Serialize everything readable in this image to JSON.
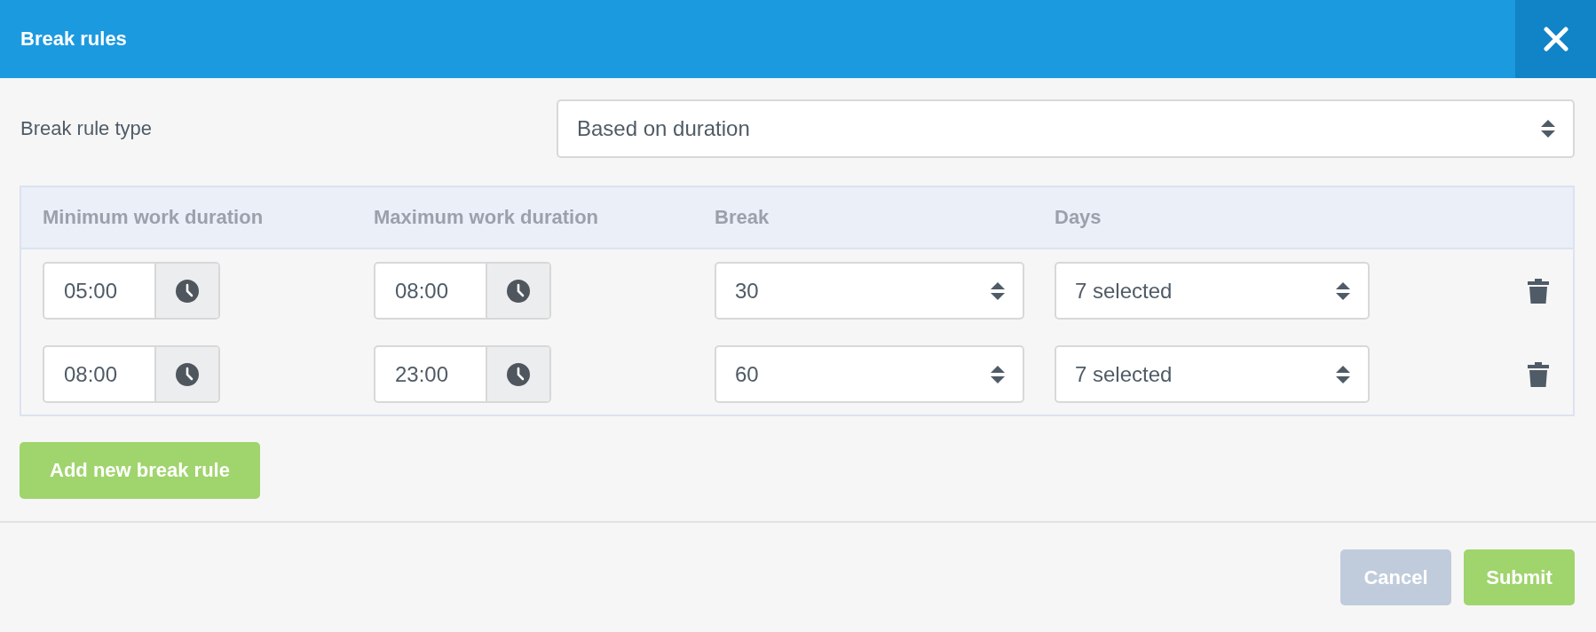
{
  "dialog": {
    "title": "Break rules"
  },
  "break_rule_type": {
    "label": "Break rule type",
    "value": "Based on duration"
  },
  "table": {
    "columns": [
      "Minimum work duration",
      "Maximum work duration",
      "Break",
      "Days"
    ],
    "rows": [
      {
        "minimum": "05:00",
        "maximum": "08:00",
        "break": "30",
        "days": "7 selected"
      },
      {
        "minimum": "08:00",
        "maximum": "23:00",
        "break": "60",
        "days": "7 selected"
      }
    ]
  },
  "add_button": "Add new break rule",
  "footer_buttons": [
    {
      "label": "Cancel",
      "kind": "secondary"
    },
    {
      "label": "Submit",
      "kind": "primary"
    }
  ]
}
